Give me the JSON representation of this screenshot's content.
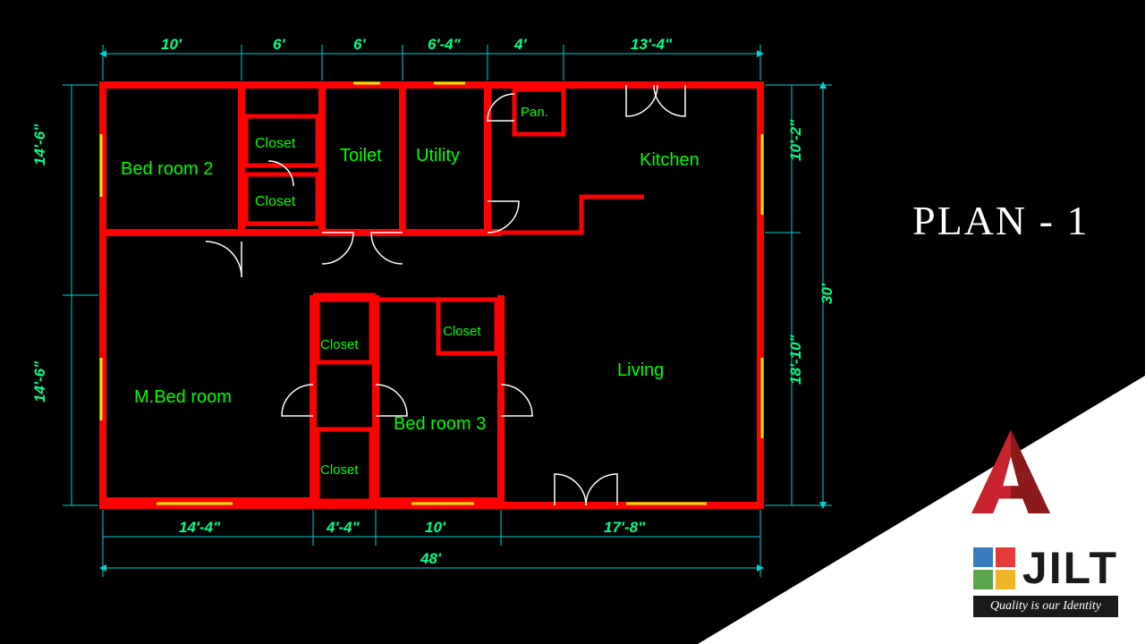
{
  "title": "PLAN - 1",
  "dimensions": {
    "top": [
      "10'",
      "6'",
      "6'",
      "6'-4\"",
      "4'",
      "13'-4\""
    ],
    "bottom_inner": [
      "14'-4\"",
      "4'-4\"",
      "10'",
      "17'-8\""
    ],
    "bottom_total": "48'",
    "left": [
      "14'-6\"",
      "14'-6\""
    ],
    "right": [
      "10'-2\"",
      "18'-10\""
    ],
    "right_total": "30'"
  },
  "rooms": {
    "bedroom2": "Bed room 2",
    "closet": "Closet",
    "toilet": "Toilet",
    "utility": "Utility",
    "pantry": "Pan.",
    "kitchen": "Kitchen",
    "mbedroom": "M.Bed room",
    "bedroom3": "Bed room 3",
    "living": "Living"
  },
  "colors": {
    "wall": "#ff0000",
    "text": "#00ff00",
    "dim": "#00d4d4",
    "dim_text": "#00ff88",
    "window": "#eaea00"
  },
  "branding": {
    "jilt": "JILT",
    "tagline": "Quality is our Identity",
    "squares": [
      "#3a7abf",
      "#e63a3a",
      "#5aa44a",
      "#f0b428"
    ]
  }
}
